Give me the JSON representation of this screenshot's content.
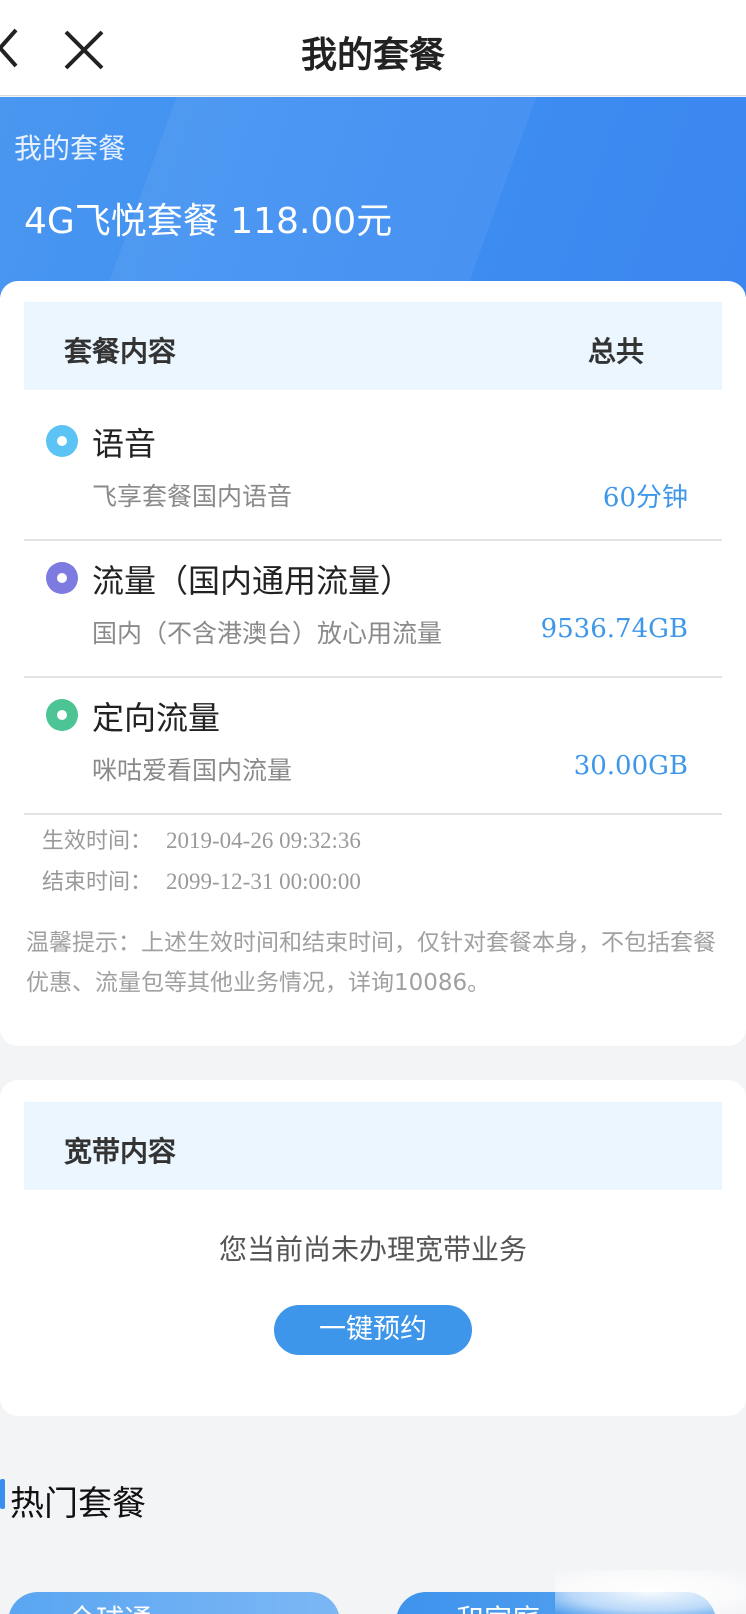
{
  "nav": {
    "title": "我的套餐"
  },
  "hero": {
    "label": "我的套餐",
    "plan": "4G飞悦套餐 118.00元"
  },
  "package": {
    "header": {
      "left": "套餐内容",
      "right": "总共"
    },
    "items": [
      {
        "name": "语音",
        "desc": "飞享套餐国内语音",
        "value": "60分钟",
        "color": "#5cc3f5"
      },
      {
        "name": "流量（国内通用流量）",
        "desc": "国内（不含港澳台）放心用流量",
        "value": "9536.74GB",
        "color": "#7d7ae0"
      },
      {
        "name": "定向流量",
        "desc": "咪咕爱看国内流量",
        "value": "30.00GB",
        "color": "#4cc494"
      }
    ],
    "start_label": "生效时间：",
    "start_value": "2019-04-26 09:32:36",
    "end_label": "结束时间：",
    "end_value": "2099-12-31 00:00:00",
    "tip": "温馨提示：上述生效时间和结束时间，仅针对套餐本身，不包括套餐优惠、流量包等其他业务情况，详询10086。"
  },
  "broadband": {
    "header": "宽带内容",
    "empty": "您当前尚未办理宽带业务",
    "button": "一键预约"
  },
  "hot": {
    "title": "热门套餐",
    "pills": [
      "全球通",
      "和家庭"
    ]
  },
  "colors": {
    "accent": "#3e96ea",
    "hero": "#3f90f2"
  }
}
